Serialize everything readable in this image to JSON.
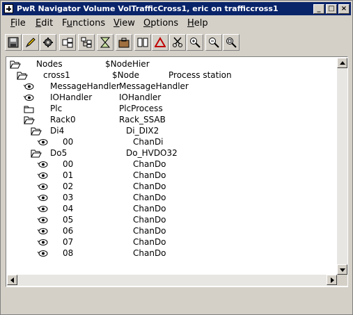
{
  "window": {
    "title": "PwR Navigator Volume VolTrafficCross1, eric on trafficcross1",
    "minimize": "_",
    "maximize": "□",
    "close": "×"
  },
  "menu": [
    {
      "label": "File",
      "mnemonic": "F"
    },
    {
      "label": "Edit",
      "mnemonic": "E"
    },
    {
      "label": "Functions",
      "mnemonic": "u"
    },
    {
      "label": "View",
      "mnemonic": "V"
    },
    {
      "label": "Options",
      "mnemonic": "O"
    },
    {
      "label": "Help",
      "mnemonic": "H"
    }
  ],
  "toolbar": [
    {
      "name": "save-button",
      "icon": "floppy-icon"
    },
    {
      "name": "edit-button",
      "icon": "pencil-icon"
    },
    {
      "name": "configure-button",
      "icon": "gear-icon"
    },
    {
      "name": "plant-button",
      "icon": "node-icon"
    },
    {
      "name": "node-hierarchy-button",
      "icon": "tree-icon"
    },
    {
      "name": "filter-button",
      "icon": "hourglass-icon"
    },
    {
      "name": "build-button",
      "icon": "package-icon"
    },
    {
      "name": "open-book-button",
      "icon": "book-icon"
    },
    {
      "name": "alarm-button",
      "icon": "warning-triangle-icon"
    },
    {
      "name": "cut-button",
      "icon": "scissors-icon"
    },
    {
      "name": "zoom-in-button",
      "icon": "zoom-in-icon"
    },
    {
      "name": "zoom-out-button",
      "icon": "zoom-out-icon"
    },
    {
      "name": "zoom-reset-button",
      "icon": "zoom-reset-icon"
    }
  ],
  "tree": [
    {
      "level": 0,
      "icon": "open-folder-icon",
      "name": "Nodes",
      "class": "$NodeHier",
      "description": ""
    },
    {
      "level": 1,
      "icon": "open-folder-icon",
      "name": "cross1",
      "class": "$Node",
      "description": "Process station"
    },
    {
      "level": 2,
      "icon": "eye-leaf-icon",
      "name": "MessageHandler",
      "class": "MessageHandler",
      "description": ""
    },
    {
      "level": 2,
      "icon": "eye-leaf-icon",
      "name": "IOHandler",
      "class": "IOHandler",
      "description": ""
    },
    {
      "level": 2,
      "icon": "closed-folder-icon",
      "name": "Plc",
      "class": "PlcProcess",
      "description": ""
    },
    {
      "level": 2,
      "icon": "open-folder-icon",
      "name": "Rack0",
      "class": "Rack_SSAB",
      "description": ""
    },
    {
      "level": 3,
      "icon": "open-folder-icon",
      "name": "Di4",
      "class": "Di_DIX2",
      "description": ""
    },
    {
      "level": 4,
      "icon": "eye-leaf-icon",
      "name": "00",
      "class": "ChanDi",
      "description": ""
    },
    {
      "level": 3,
      "icon": "open-folder-icon",
      "name": "Do5",
      "class": "Do_HVDO32",
      "description": ""
    },
    {
      "level": 4,
      "icon": "eye-leaf-icon",
      "name": "00",
      "class": "ChanDo",
      "description": ""
    },
    {
      "level": 4,
      "icon": "eye-leaf-icon",
      "name": "01",
      "class": "ChanDo",
      "description": ""
    },
    {
      "level": 4,
      "icon": "eye-leaf-icon",
      "name": "02",
      "class": "ChanDo",
      "description": ""
    },
    {
      "level": 4,
      "icon": "eye-leaf-icon",
      "name": "03",
      "class": "ChanDo",
      "description": ""
    },
    {
      "level": 4,
      "icon": "eye-leaf-icon",
      "name": "04",
      "class": "ChanDo",
      "description": ""
    },
    {
      "level": 4,
      "icon": "eye-leaf-icon",
      "name": "05",
      "class": "ChanDo",
      "description": ""
    },
    {
      "level": 4,
      "icon": "eye-leaf-icon",
      "name": "06",
      "class": "ChanDo",
      "description": ""
    },
    {
      "level": 4,
      "icon": "eye-leaf-icon",
      "name": "07",
      "class": "ChanDo",
      "description": ""
    },
    {
      "level": 4,
      "icon": "eye-leaf-icon",
      "name": "08",
      "class": "ChanDo",
      "description": ""
    }
  ],
  "status": ""
}
